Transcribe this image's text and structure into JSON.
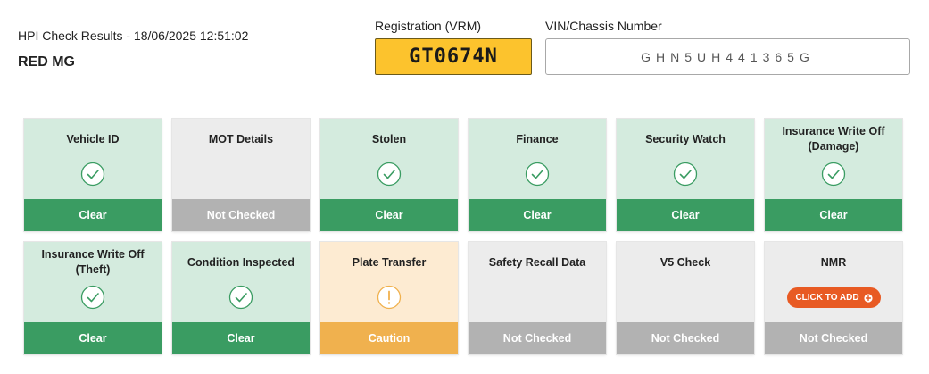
{
  "header": {
    "title": "HPI Check Results - 18/06/2025 12:51:02",
    "vehicle_name": "RED MG",
    "vrm_label": "Registration (VRM)",
    "vrm_value": "GT0674N",
    "vin_label": "VIN/Chassis Number",
    "vin_value": "GHN5UH441365G"
  },
  "colors": {
    "clear": "#3a9c62",
    "clear_bg": "#d4ebde",
    "not_checked": "#b2b2b2",
    "caution": "#f0b14e",
    "plate": "#fcc32d",
    "add_button": "#e85a23"
  },
  "checks": [
    {
      "name": "Vehicle ID",
      "status": "Clear",
      "icon": "check-circle-icon"
    },
    {
      "name": "MOT Details",
      "status": "Not Checked"
    },
    {
      "name": "Stolen",
      "status": "Clear",
      "icon": "check-circle-icon"
    },
    {
      "name": "Finance",
      "status": "Clear",
      "icon": "check-circle-icon"
    },
    {
      "name": "Security Watch",
      "status": "Clear",
      "icon": "check-circle-icon"
    },
    {
      "name": "Insurance Write Off (Damage)",
      "status": "Clear",
      "icon": "check-circle-icon"
    },
    {
      "name": "Insurance Write Off (Theft)",
      "status": "Clear",
      "icon": "check-circle-icon"
    },
    {
      "name": "Condition Inspected",
      "status": "Clear",
      "icon": "check-circle-icon"
    },
    {
      "name": "Plate Transfer",
      "status": "Caution",
      "icon": "exclamation-circle-icon"
    },
    {
      "name": "Safety Recall Data",
      "status": "Not Checked"
    },
    {
      "name": "V5 Check",
      "status": "Not Checked"
    },
    {
      "name": "NMR",
      "status": "Not Checked",
      "action_label": "CLICK TO ADD",
      "action_icon": "plus-circle-icon"
    }
  ]
}
